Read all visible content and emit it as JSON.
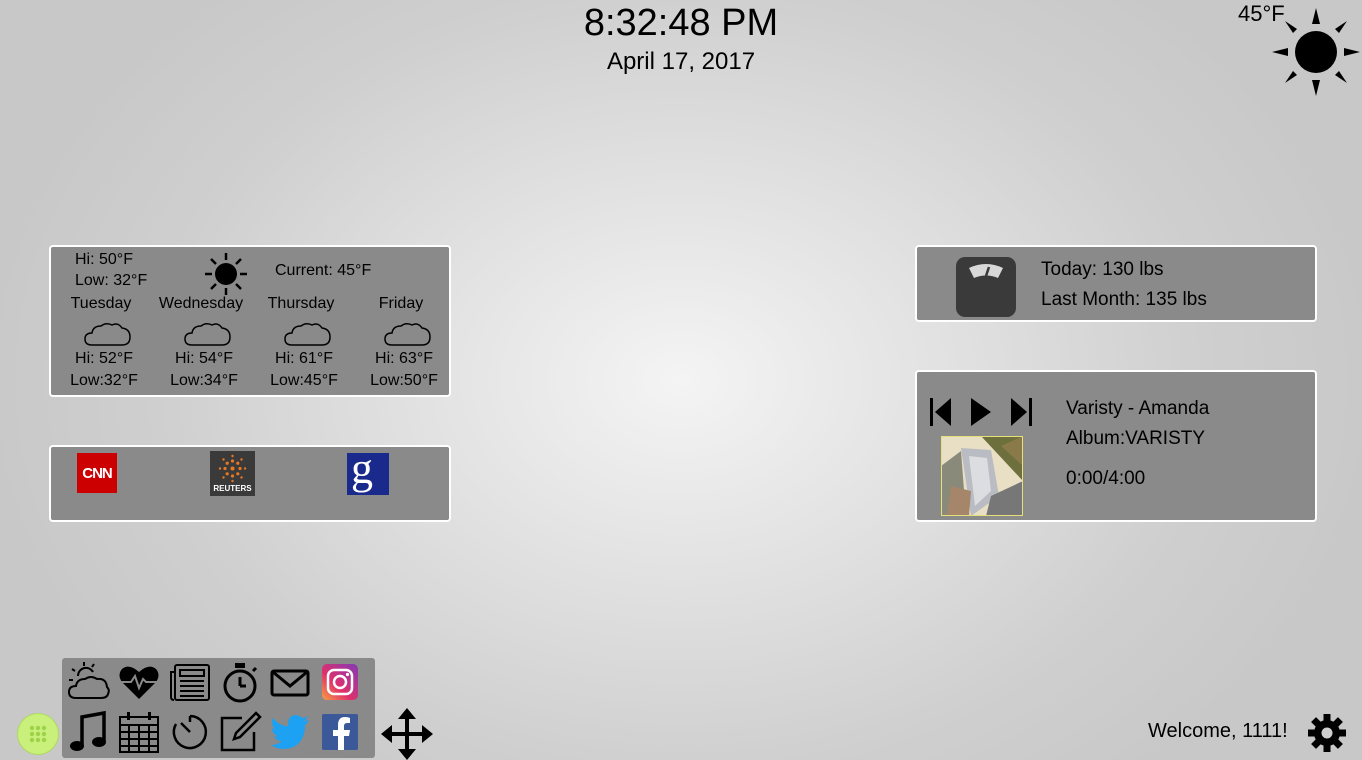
{
  "clock": {
    "time": "8:32:48 PM",
    "date": "April 17, 2017"
  },
  "top_weather": {
    "temp": "45°F",
    "icon": "sun-icon"
  },
  "weather": {
    "today_hi": "Hi: 50°F",
    "today_low": "Low: 32°F",
    "current": "Current: 45°F",
    "forecast": [
      {
        "day": "Tuesday",
        "hi": "Hi: 52°F",
        "low": "Low:32°F",
        "icon": "cloud-icon"
      },
      {
        "day": "Wednesday",
        "hi": "Hi: 54°F",
        "low": "Low:34°F",
        "icon": "cloud-icon"
      },
      {
        "day": "Thursday",
        "hi": "Hi: 61°F",
        "low": "Low:45°F",
        "icon": "cloud-icon"
      },
      {
        "day": "Friday",
        "hi": "Hi: 63°F",
        "low": "Low:50°F",
        "icon": "cloud-icon"
      }
    ]
  },
  "news": {
    "sources": [
      {
        "name": "cnn",
        "label": "CNN",
        "color": "#cc0000"
      },
      {
        "name": "reuters",
        "label": "REUTERS",
        "color": "#3a3a3a"
      },
      {
        "name": "google-news",
        "label": "g",
        "color": "#1a2a8c"
      }
    ]
  },
  "weight": {
    "today": "Today: 130 lbs",
    "last_month": "Last Month: 135 lbs",
    "icon": "scale-icon"
  },
  "music": {
    "title": "Varisty - Amanda",
    "album": "Album:VARISTY",
    "progress": "0:00/4:00",
    "controls": [
      "previous-icon",
      "play-icon",
      "next-icon"
    ]
  },
  "dock": {
    "row1": [
      "weather-icon",
      "heart-rate-icon",
      "newspaper-icon",
      "stopwatch-icon",
      "mail-icon",
      "instagram-icon"
    ],
    "row2": [
      "music-note-icon",
      "calendar-icon",
      "timer-icon",
      "edit-icon",
      "twitter-icon",
      "facebook-icon"
    ]
  },
  "footer": {
    "welcome": "Welcome, 1111!"
  },
  "colors": {
    "panel": "#8a8a8a",
    "apps_button": "#c8f07a",
    "twitter": "#1da1f2",
    "facebook": "#3b5998"
  }
}
